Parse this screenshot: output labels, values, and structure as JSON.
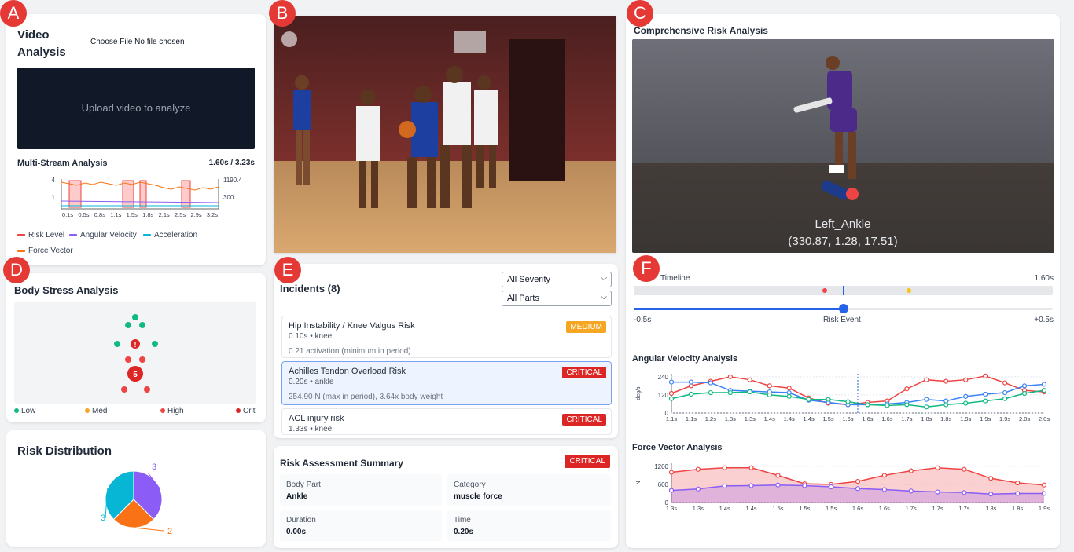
{
  "badges": {
    "a": "A",
    "b": "B",
    "c": "C",
    "d": "D",
    "e": "E",
    "f": "F"
  },
  "video": {
    "title_line1": "Video",
    "title_line2": "Analysis",
    "file_button": "Choose File",
    "file_status": "No file chosen",
    "upload_prompt": "Upload video to analyze"
  },
  "multistream": {
    "title": "Multi-Stream Analysis",
    "time": "1.60s / 3.23s",
    "y_left": [
      "4",
      "1"
    ],
    "y_right": [
      "1190.4",
      "300"
    ],
    "x_ticks": [
      "0.1s",
      "0.5s",
      "0.8s",
      "1.1s",
      "1.5s",
      "1.8s",
      "2.1s",
      "2.5s",
      "2.9s",
      "3.2s"
    ],
    "legend": [
      {
        "label": "Risk Level",
        "color": "#ef4444"
      },
      {
        "label": "Angular Velocity",
        "color": "#8b5cf6"
      },
      {
        "label": "Acceleration",
        "color": "#06b6d4"
      },
      {
        "label": "Force Vector",
        "color": "#f97316"
      }
    ]
  },
  "body_stress": {
    "title": "Body Stress Analysis",
    "markers": [
      "!",
      "5"
    ],
    "legend": [
      {
        "label": "Low",
        "color": "#10b981"
      },
      {
        "label": "Med",
        "color": "#f5a623"
      },
      {
        "label": "High",
        "color": "#ef4444"
      },
      {
        "label": "Crit",
        "color": "#dc2626"
      }
    ]
  },
  "risk_dist": {
    "title": "Risk Distribution"
  },
  "incidents": {
    "title": "Incidents (8)",
    "severity": "All Severity",
    "parts": "All Parts",
    "items": [
      {
        "title": "Hip Instability / Knee Valgus Risk",
        "sub": "0.10s • knee",
        "detail": "0.21 activation (minimum in period)",
        "tag": "MEDIUM"
      },
      {
        "title": "Achilles Tendon Overload Risk",
        "sub": "0.20s • ankle",
        "detail": "254.90 N (max in period), 3.64x body weight",
        "tag": "CRITICAL"
      },
      {
        "title": "ACL injury risk",
        "sub": "1.33s • knee",
        "tag": "CRITICAL"
      }
    ]
  },
  "summary": {
    "title": "Risk Assessment Summary",
    "tag": "CRITICAL",
    "cells": [
      {
        "k": "Body Part",
        "v": "Ankle"
      },
      {
        "k": "Category",
        "v": "muscle force"
      },
      {
        "k": "Duration",
        "v": "0.00s"
      },
      {
        "k": "Time",
        "v": "0.20s"
      }
    ]
  },
  "comprehensive": {
    "title": "Comprehensive Risk Analysis",
    "joint": "Left_Ankle",
    "coords": "(330.87, 1.28, 17.51)"
  },
  "timeline": {
    "title": "Timeline",
    "time": "1.60s",
    "left": "-0.5s",
    "center": "Risk Event",
    "right": "+0.5s",
    "slider_value": 0.5
  },
  "angular": {
    "title": "Angular Velocity Analysis",
    "ylabel": "deg/s",
    "y_ticks": [
      "240",
      "120",
      "0"
    ],
    "x_ticks": [
      "1.1s",
      "1.1s",
      "1.2s",
      "1.3s",
      "1.3s",
      "1.4s",
      "1.4s",
      "1.4s",
      "1.5s",
      "1.6s",
      "1.6s",
      "1.6s",
      "1.7s",
      "1.8s",
      "1.8s",
      "1.9s",
      "1.9s",
      "1.9s",
      "2.0s",
      "2.0s"
    ]
  },
  "force": {
    "title": "Force Vector Analysis",
    "ylabel": "N",
    "y_ticks": [
      "1200",
      "600",
      "0"
    ],
    "x_ticks": [
      "1.3s",
      "1.3s",
      "1.4s",
      "1.4s",
      "1.5s",
      "1.5s",
      "1.5s",
      "1.6s",
      "1.6s",
      "1.7s",
      "1.7s",
      "1.7s",
      "1.8s",
      "1.8s",
      "1.9s"
    ]
  },
  "chart_data": [
    {
      "type": "pie",
      "title": "Risk Distribution",
      "labels": [
        "3",
        "2",
        "3"
      ],
      "values": [
        3,
        2,
        3
      ],
      "colors": [
        "#8b5cf6",
        "#f97316",
        "#06b6d4"
      ]
    },
    {
      "type": "line",
      "title": "Angular Velocity Analysis",
      "ylabel": "deg/s",
      "ylim": [
        0,
        260
      ],
      "series": [
        {
          "color": "#ef4444",
          "values": [
            130,
            180,
            210,
            240,
            220,
            180,
            165,
            100,
            65,
            55,
            70,
            80,
            160,
            220,
            210,
            220,
            245,
            200,
            150,
            140
          ]
        },
        {
          "color": "#3b82f6",
          "values": [
            205,
            205,
            200,
            150,
            145,
            140,
            135,
            85,
            70,
            55,
            55,
            60,
            70,
            90,
            80,
            110,
            125,
            135,
            180,
            190
          ]
        },
        {
          "color": "#10b981",
          "values": [
            95,
            125,
            135,
            135,
            140,
            120,
            110,
            90,
            90,
            75,
            55,
            50,
            55,
            40,
            55,
            65,
            80,
            95,
            130,
            150
          ]
        }
      ]
    },
    {
      "type": "area",
      "title": "Force Vector Analysis",
      "ylabel": "N",
      "ylim": [
        0,
        1300
      ],
      "series": [
        {
          "color": "#ef4444",
          "values": [
            1000,
            1100,
            1150,
            1150,
            900,
            620,
            600,
            700,
            900,
            1050,
            1150,
            1100,
            800,
            650,
            580
          ]
        },
        {
          "color": "#8b5cf6",
          "values": [
            400,
            450,
            550,
            560,
            580,
            560,
            520,
            460,
            430,
            380,
            350,
            330,
            280,
            300,
            300
          ]
        }
      ]
    }
  ]
}
